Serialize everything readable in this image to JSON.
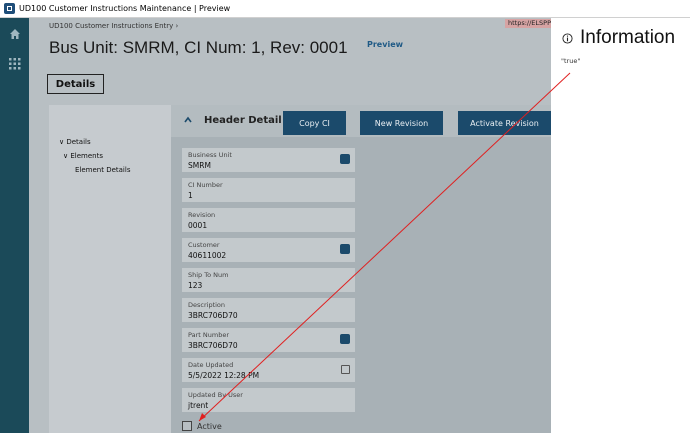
{
  "window": {
    "title": "UD100 Customer Instructions Maintenance | Preview"
  },
  "breadcrumb": "UD100 Customer Instructions Entry  ›",
  "url_badge": "https://ELSPPIL",
  "page": {
    "title": "Bus Unit: SMRM, CI Num: 1, Rev: 0001",
    "preview_label": "Preview"
  },
  "details_button": "Details",
  "tree": {
    "root": "∨ Details",
    "child": "∨ Elements",
    "leaf": "Element Details"
  },
  "header": {
    "title": "Header Detail",
    "buttons": {
      "copy": "Copy CI",
      "new_revision": "New Revision",
      "activate_revision": "Activate Revision"
    }
  },
  "fields": {
    "business_unit": {
      "label": "Business Unit",
      "value": "SMRM"
    },
    "ci_number": {
      "label": "CI Number",
      "value": "1"
    },
    "revision": {
      "label": "Revision",
      "value": "0001"
    },
    "customer": {
      "label": "Customer",
      "value": "40611002"
    },
    "ship_to": {
      "label": "Ship To Num",
      "value": "123"
    },
    "description": {
      "label": "Description",
      "value": "3BRC706D70"
    },
    "part_number": {
      "label": "Part Number",
      "value": "3BRC706D70"
    },
    "date_updated": {
      "label": "Date Updated",
      "value": "5/5/2022 12:28 PM"
    },
    "updated_by": {
      "label": "Updated By User",
      "value": "jtrent"
    }
  },
  "active": {
    "label": "Active"
  },
  "info_panel": {
    "title": "Information",
    "value": "\"true\""
  },
  "colors": {
    "rail": "#1b4a59",
    "button": "#1b4a6b",
    "arrow": "#e02020"
  }
}
